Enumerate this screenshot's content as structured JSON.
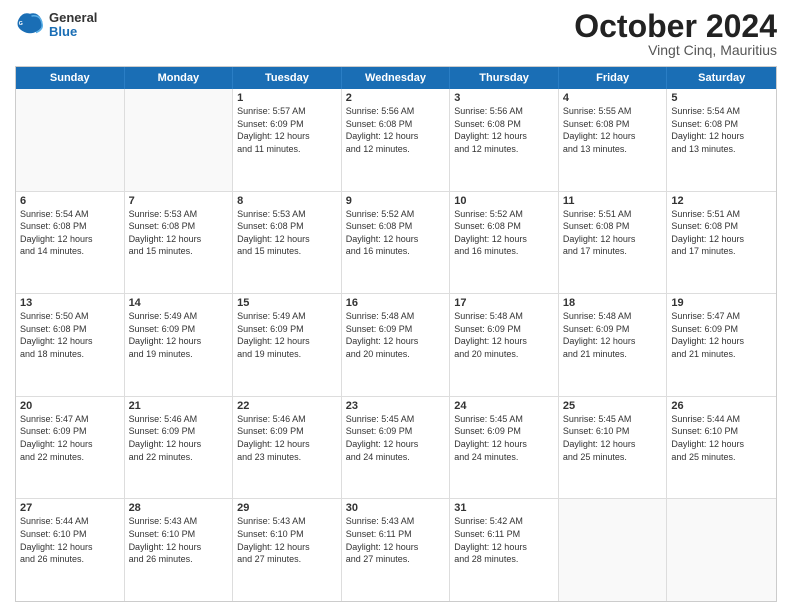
{
  "header": {
    "logo": {
      "general": "General",
      "blue": "Blue"
    },
    "month": "October 2024",
    "location": "Vingt Cinq, Mauritius"
  },
  "weekdays": [
    "Sunday",
    "Monday",
    "Tuesday",
    "Wednesday",
    "Thursday",
    "Friday",
    "Saturday"
  ],
  "rows": [
    [
      {
        "day": "",
        "empty": true
      },
      {
        "day": "",
        "empty": true
      },
      {
        "day": "1",
        "lines": [
          "Sunrise: 5:57 AM",
          "Sunset: 6:09 PM",
          "Daylight: 12 hours",
          "and 11 minutes."
        ]
      },
      {
        "day": "2",
        "lines": [
          "Sunrise: 5:56 AM",
          "Sunset: 6:08 PM",
          "Daylight: 12 hours",
          "and 12 minutes."
        ]
      },
      {
        "day": "3",
        "lines": [
          "Sunrise: 5:56 AM",
          "Sunset: 6:08 PM",
          "Daylight: 12 hours",
          "and 12 minutes."
        ]
      },
      {
        "day": "4",
        "lines": [
          "Sunrise: 5:55 AM",
          "Sunset: 6:08 PM",
          "Daylight: 12 hours",
          "and 13 minutes."
        ]
      },
      {
        "day": "5",
        "lines": [
          "Sunrise: 5:54 AM",
          "Sunset: 6:08 PM",
          "Daylight: 12 hours",
          "and 13 minutes."
        ]
      }
    ],
    [
      {
        "day": "6",
        "lines": [
          "Sunrise: 5:54 AM",
          "Sunset: 6:08 PM",
          "Daylight: 12 hours",
          "and 14 minutes."
        ]
      },
      {
        "day": "7",
        "lines": [
          "Sunrise: 5:53 AM",
          "Sunset: 6:08 PM",
          "Daylight: 12 hours",
          "and 15 minutes."
        ]
      },
      {
        "day": "8",
        "lines": [
          "Sunrise: 5:53 AM",
          "Sunset: 6:08 PM",
          "Daylight: 12 hours",
          "and 15 minutes."
        ]
      },
      {
        "day": "9",
        "lines": [
          "Sunrise: 5:52 AM",
          "Sunset: 6:08 PM",
          "Daylight: 12 hours",
          "and 16 minutes."
        ]
      },
      {
        "day": "10",
        "lines": [
          "Sunrise: 5:52 AM",
          "Sunset: 6:08 PM",
          "Daylight: 12 hours",
          "and 16 minutes."
        ]
      },
      {
        "day": "11",
        "lines": [
          "Sunrise: 5:51 AM",
          "Sunset: 6:08 PM",
          "Daylight: 12 hours",
          "and 17 minutes."
        ]
      },
      {
        "day": "12",
        "lines": [
          "Sunrise: 5:51 AM",
          "Sunset: 6:08 PM",
          "Daylight: 12 hours",
          "and 17 minutes."
        ]
      }
    ],
    [
      {
        "day": "13",
        "lines": [
          "Sunrise: 5:50 AM",
          "Sunset: 6:08 PM",
          "Daylight: 12 hours",
          "and 18 minutes."
        ]
      },
      {
        "day": "14",
        "lines": [
          "Sunrise: 5:49 AM",
          "Sunset: 6:09 PM",
          "Daylight: 12 hours",
          "and 19 minutes."
        ]
      },
      {
        "day": "15",
        "lines": [
          "Sunrise: 5:49 AM",
          "Sunset: 6:09 PM",
          "Daylight: 12 hours",
          "and 19 minutes."
        ]
      },
      {
        "day": "16",
        "lines": [
          "Sunrise: 5:48 AM",
          "Sunset: 6:09 PM",
          "Daylight: 12 hours",
          "and 20 minutes."
        ]
      },
      {
        "day": "17",
        "lines": [
          "Sunrise: 5:48 AM",
          "Sunset: 6:09 PM",
          "Daylight: 12 hours",
          "and 20 minutes."
        ]
      },
      {
        "day": "18",
        "lines": [
          "Sunrise: 5:48 AM",
          "Sunset: 6:09 PM",
          "Daylight: 12 hours",
          "and 21 minutes."
        ]
      },
      {
        "day": "19",
        "lines": [
          "Sunrise: 5:47 AM",
          "Sunset: 6:09 PM",
          "Daylight: 12 hours",
          "and 21 minutes."
        ]
      }
    ],
    [
      {
        "day": "20",
        "lines": [
          "Sunrise: 5:47 AM",
          "Sunset: 6:09 PM",
          "Daylight: 12 hours",
          "and 22 minutes."
        ]
      },
      {
        "day": "21",
        "lines": [
          "Sunrise: 5:46 AM",
          "Sunset: 6:09 PM",
          "Daylight: 12 hours",
          "and 22 minutes."
        ]
      },
      {
        "day": "22",
        "lines": [
          "Sunrise: 5:46 AM",
          "Sunset: 6:09 PM",
          "Daylight: 12 hours",
          "and 23 minutes."
        ]
      },
      {
        "day": "23",
        "lines": [
          "Sunrise: 5:45 AM",
          "Sunset: 6:09 PM",
          "Daylight: 12 hours",
          "and 24 minutes."
        ]
      },
      {
        "day": "24",
        "lines": [
          "Sunrise: 5:45 AM",
          "Sunset: 6:09 PM",
          "Daylight: 12 hours",
          "and 24 minutes."
        ]
      },
      {
        "day": "25",
        "lines": [
          "Sunrise: 5:45 AM",
          "Sunset: 6:10 PM",
          "Daylight: 12 hours",
          "and 25 minutes."
        ]
      },
      {
        "day": "26",
        "lines": [
          "Sunrise: 5:44 AM",
          "Sunset: 6:10 PM",
          "Daylight: 12 hours",
          "and 25 minutes."
        ]
      }
    ],
    [
      {
        "day": "27",
        "lines": [
          "Sunrise: 5:44 AM",
          "Sunset: 6:10 PM",
          "Daylight: 12 hours",
          "and 26 minutes."
        ]
      },
      {
        "day": "28",
        "lines": [
          "Sunrise: 5:43 AM",
          "Sunset: 6:10 PM",
          "Daylight: 12 hours",
          "and 26 minutes."
        ]
      },
      {
        "day": "29",
        "lines": [
          "Sunrise: 5:43 AM",
          "Sunset: 6:10 PM",
          "Daylight: 12 hours",
          "and 27 minutes."
        ]
      },
      {
        "day": "30",
        "lines": [
          "Sunrise: 5:43 AM",
          "Sunset: 6:11 PM",
          "Daylight: 12 hours",
          "and 27 minutes."
        ]
      },
      {
        "day": "31",
        "lines": [
          "Sunrise: 5:42 AM",
          "Sunset: 6:11 PM",
          "Daylight: 12 hours",
          "and 28 minutes."
        ]
      },
      {
        "day": "",
        "empty": true
      },
      {
        "day": "",
        "empty": true
      }
    ]
  ]
}
